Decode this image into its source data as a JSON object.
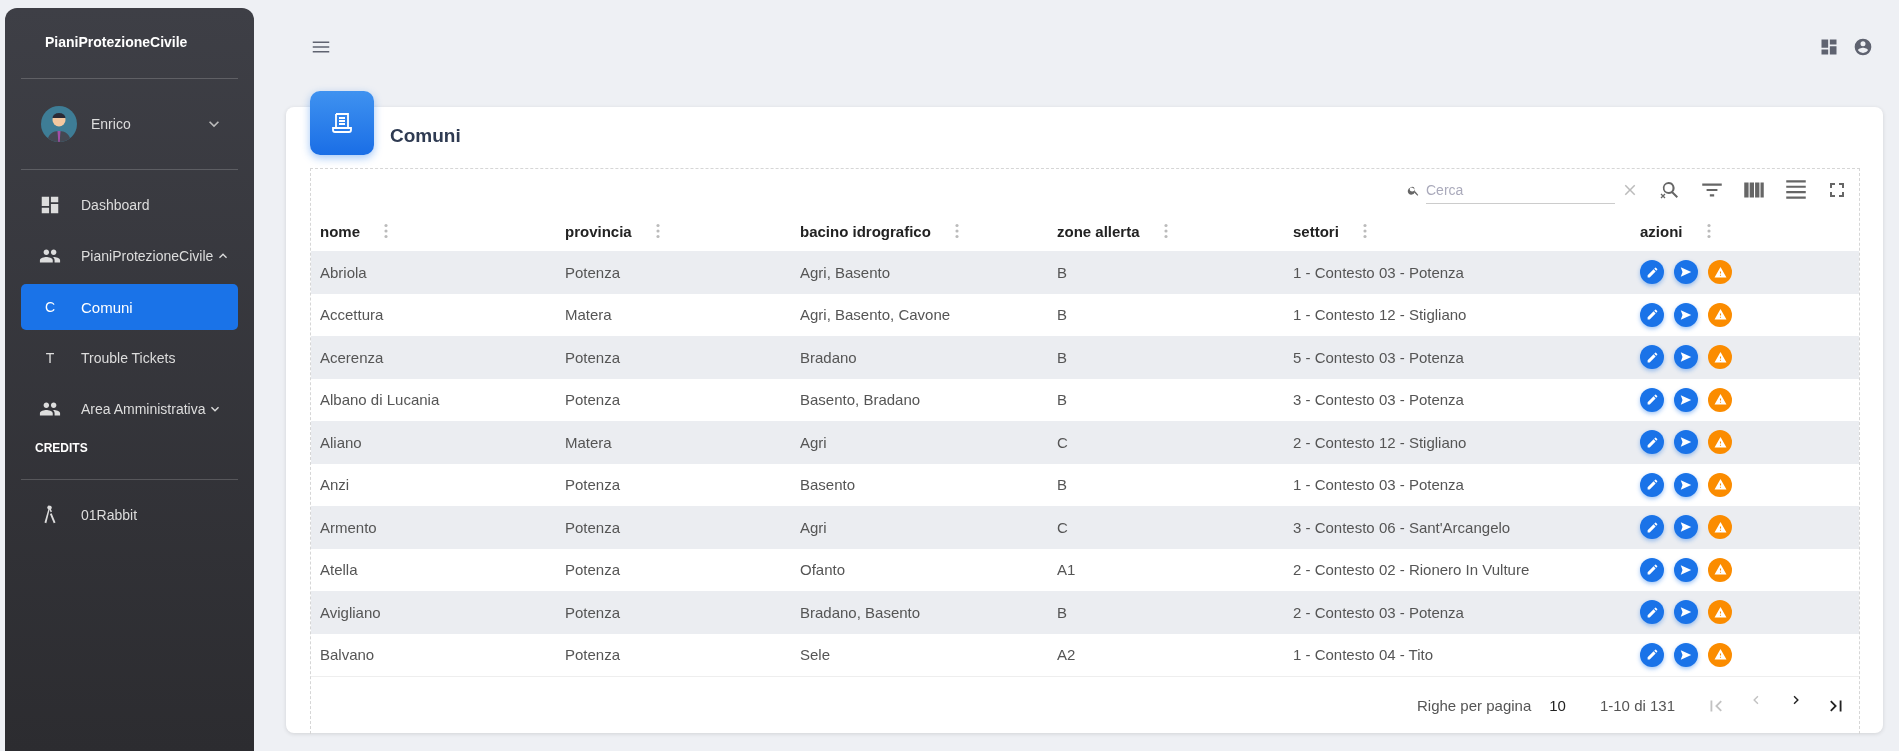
{
  "sidebar": {
    "title": "PianiProtezioneCivile",
    "user": {
      "name": "Enrico",
      "expanded": false
    },
    "items": [
      {
        "kind": "link",
        "label": "Dashboard",
        "selected": false
      },
      {
        "kind": "group",
        "label": "PianiProtezioneCivile",
        "expanded": true
      },
      {
        "kind": "link",
        "letter": "C",
        "label": "Comuni",
        "selected": true
      },
      {
        "kind": "link",
        "letter": "T",
        "label": "Trouble Tickets",
        "selected": false
      },
      {
        "kind": "group",
        "label": "Area Amministrativa",
        "expanded": false
      },
      {
        "kind": "section",
        "label": "CREDITS"
      },
      {
        "kind": "link",
        "label": "01Rabbit",
        "selected": false
      }
    ]
  },
  "card": {
    "title": "Comuni",
    "search": {
      "placeholder": "Cerca"
    },
    "columns": [
      "nome",
      "provincia",
      "bacino idrografico",
      "zone allerta",
      "settori",
      "azioni"
    ],
    "rows": [
      [
        "Abriola",
        "Potenza",
        "Agri, Basento",
        "B",
        "1 - Contesto 03 - Potenza"
      ],
      [
        "Accettura",
        "Matera",
        "Agri, Basento, Cavone",
        "B",
        "1 - Contesto 12 - Stigliano"
      ],
      [
        "Acerenza",
        "Potenza",
        "Bradano",
        "B",
        "5 - Contesto 03 - Potenza"
      ],
      [
        "Albano di Lucania",
        "Potenza",
        "Basento, Bradano",
        "B",
        "3 - Contesto 03 - Potenza"
      ],
      [
        "Aliano",
        "Matera",
        "Agri",
        "C",
        "2 - Contesto 12 - Stigliano"
      ],
      [
        "Anzi",
        "Potenza",
        "Basento",
        "B",
        "1 - Contesto 03 - Potenza"
      ],
      [
        "Armento",
        "Potenza",
        "Agri",
        "C",
        "3 - Contesto 06 - Sant'Arcangelo"
      ],
      [
        "Atella",
        "Potenza",
        "Ofanto",
        "A1",
        "2 - Contesto 02 - Rionero In Vulture"
      ],
      [
        "Avigliano",
        "Potenza",
        "Bradano, Basento",
        "B",
        "2 - Contesto 03 - Potenza"
      ],
      [
        "Balvano",
        "Potenza",
        "Sele",
        "A2",
        "1 - Contesto 04 - Tito"
      ]
    ],
    "pagination": {
      "rows_per_page_label": "Righe per pagina",
      "rows_per_page": "10",
      "range": "1-10 di 131",
      "buttons": [
        {
          "kind": "first",
          "disabled": true
        },
        {
          "kind": "prev",
          "disabled": true
        },
        {
          "kind": "next",
          "disabled": false
        },
        {
          "kind": "last",
          "disabled": false
        }
      ]
    }
  }
}
